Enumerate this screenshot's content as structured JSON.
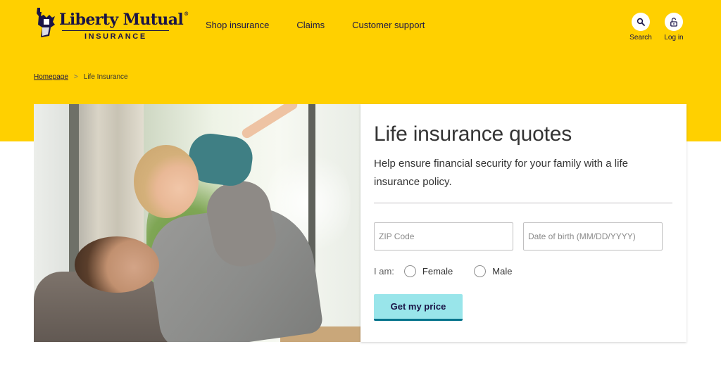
{
  "brand": {
    "name": "Liberty Mutual",
    "subtitle": "INSURANCE",
    "registered_mark": "®",
    "colors": {
      "yellow": "#ffd000",
      "navy": "#1a1446",
      "teal_button": "#99e5ea",
      "teal_underline": "#06748c"
    }
  },
  "nav": {
    "items": [
      {
        "label": "Shop insurance"
      },
      {
        "label": "Claims"
      },
      {
        "label": "Customer support"
      }
    ]
  },
  "utility": {
    "search": {
      "label": "Search",
      "icon": "search-icon"
    },
    "login": {
      "label": "Log in",
      "icon": "unlock-icon"
    }
  },
  "breadcrumb": {
    "items": [
      {
        "label": "Homepage",
        "link": true
      },
      {
        "label": "Life Insurance",
        "link": false
      }
    ],
    "separator": ">"
  },
  "hero": {
    "image_alt": "Father lifting young child in the air by a window"
  },
  "quote_form": {
    "title": "Life insurance quotes",
    "description": "Help ensure financial security for your family with a life insurance policy.",
    "zip": {
      "placeholder": "ZIP Code",
      "value": ""
    },
    "dob": {
      "placeholder": "Date of birth (MM/DD/YYYY)",
      "value": ""
    },
    "gender": {
      "label": "I am:",
      "options": [
        {
          "label": "Female",
          "checked": false
        },
        {
          "label": "Male",
          "checked": false
        }
      ]
    },
    "submit_label": "Get my price"
  }
}
